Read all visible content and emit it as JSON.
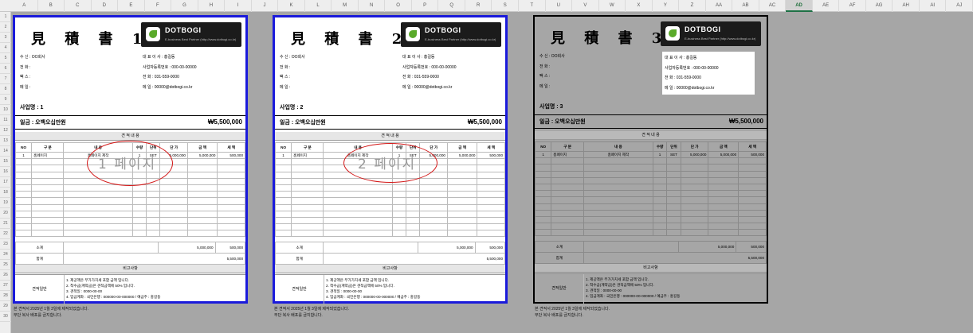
{
  "sheet": {
    "column_letters": [
      "A",
      "B",
      "C",
      "D",
      "E",
      "F",
      "G",
      "H",
      "I",
      "J",
      "K",
      "L",
      "M",
      "N",
      "O",
      "P",
      "Q",
      "R",
      "S",
      "T",
      "U",
      "V",
      "W",
      "X",
      "Y",
      "Z",
      "AA",
      "AB",
      "AC",
      "AD",
      "AE",
      "AF",
      "AG",
      "AH",
      "AI",
      "AJ"
    ],
    "selected_column": "AD",
    "row_numbers": [
      "1",
      "2",
      "3",
      "4",
      "5",
      "6",
      "7",
      "8",
      "9",
      "10",
      "11",
      "12",
      "13",
      "14",
      "15",
      "16",
      "17",
      "18",
      "19",
      "20",
      "21",
      "22",
      "23",
      "24",
      "25",
      "26",
      "27",
      "28",
      "29",
      "30"
    ]
  },
  "quotes": [
    {
      "title": "見 積 書 1",
      "stamp_text": "1 페이지",
      "business_name": "사업명 : 1"
    },
    {
      "title": "見 積 書 2",
      "stamp_text": "2 페이지",
      "business_name": "사업명 : 2"
    },
    {
      "title": "見 積 書 3",
      "stamp_text": "",
      "business_name": "사업명 : 3"
    }
  ],
  "logo": {
    "name": "DOTBOGI",
    "tagline": "E-business Best Partner  (http://www.dotbogi.co.kr)"
  },
  "recipient": {
    "to": "수   신 : OO회사",
    "phone": "전   화 :",
    "fax": "팩   스 :",
    "email": "메   일 :"
  },
  "supplier": {
    "ceo": "대   표   이   사  :  홍길동",
    "biz_no": "사업자등록번호 :  000-00-00000",
    "phone": "전      화      :  031-559-0000",
    "email": "메      일      :  00000@dotbogi.co.kr"
  },
  "amount": {
    "label": "일금 : 오백오십만원",
    "value": "₩5,500,000"
  },
  "section_detail": "견 적 내 용",
  "table": {
    "headers": [
      "NO",
      "구 분",
      "내      용",
      "수량",
      "단위",
      "단 가",
      "금 액",
      "세 액"
    ],
    "rows": [
      [
        "1",
        "홈페이지",
        "홈페이지 제작",
        "1",
        "SET",
        "5,000,000",
        "5,000,000",
        "500,000"
      ]
    ]
  },
  "subtotal": {
    "label": "소계",
    "amount": "5,000,000",
    "tax": "500,000"
  },
  "total": {
    "label": "합계",
    "value": "5,500,000"
  },
  "section_remarks": "비고사항",
  "remarks": {
    "key": "견적일반",
    "lines": [
      "1. 제공액은 부가가치세 포함 금액 입니다.",
      "2. 착수금(계약금)은 견적금액에 50% 입니다.",
      "3. 견적일 : 0000-00-00",
      "4. 입금계좌 : 국민은행 : 000000-00-000000  / 예금주 : 홍길동"
    ]
  },
  "footnote": [
    "본 견적서 2025년 1월 3일에 제작되었습니다.",
    "무단 복사 배포를 금지합니다."
  ],
  "colors": {
    "selected_border": "#1a1adb",
    "stamp": "#d31717",
    "logo_bg": "#1b1b1b",
    "logo_leaf": "#5aaa2a",
    "sheet_bg": "#a6a6a6"
  }
}
